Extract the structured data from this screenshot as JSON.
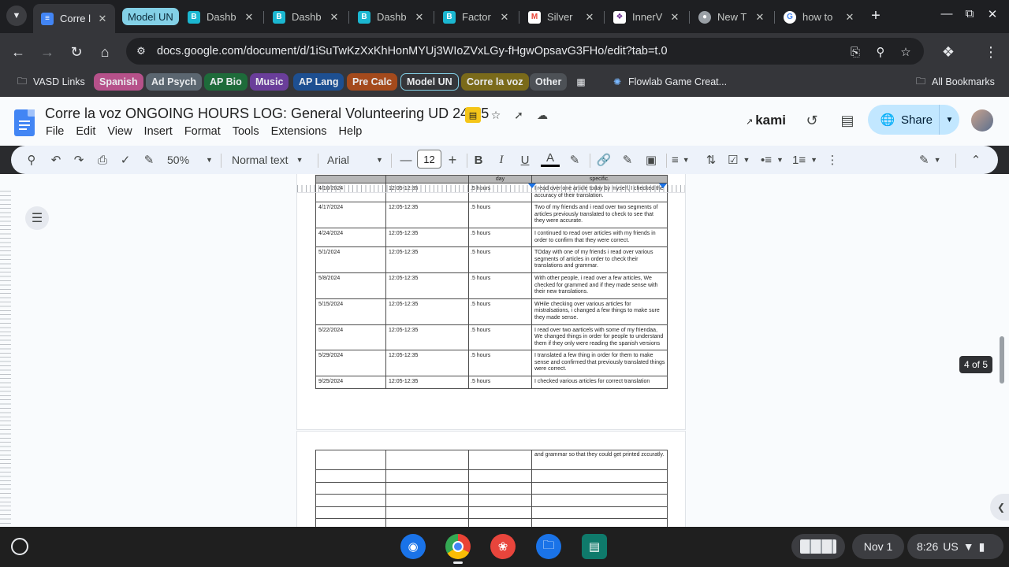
{
  "browser": {
    "tabs": [
      {
        "title": "Corre l",
        "favicon": "docs-icon",
        "color": "#4285f4",
        "active": true
      },
      {
        "title": "Dashb",
        "favicon": "b-icon",
        "color": "#1bb7d1"
      },
      {
        "title": "Dashb",
        "favicon": "b-icon",
        "color": "#1bb7d1"
      },
      {
        "title": "Dashb",
        "favicon": "b-icon",
        "color": "#1bb7d1"
      },
      {
        "title": "Factor",
        "favicon": "b-icon",
        "color": "#1bb7d1"
      },
      {
        "title": "Silver",
        "favicon": "gmail-icon",
        "color": "#ea4335"
      },
      {
        "title": "InnerV",
        "favicon": "innerv-icon",
        "color": "#6a2c91"
      },
      {
        "title": "New T",
        "favicon": "chrome-icon",
        "color": "#9aa0a6"
      },
      {
        "title": "how to",
        "favicon": "google-icon",
        "color": "#4285f4"
      }
    ],
    "tab_group": "Model UN",
    "url": "docs.google.com/document/d/1iSuTwKzXxKhHonMYUj3WIoZVxLGy-fHgwOpsavG3FHo/edit?tab=t.0",
    "bookmarks": [
      {
        "label": "VASD Links",
        "type": "folder"
      },
      {
        "label": "Spanish",
        "type": "group",
        "color": "#b6518a"
      },
      {
        "label": "Ad Psych",
        "type": "group",
        "color": "#5b6670"
      },
      {
        "label": "AP Bio",
        "type": "group",
        "color": "#1e6b3a"
      },
      {
        "label": "Music",
        "type": "group",
        "color": "#6a3e9a"
      },
      {
        "label": "AP Lang",
        "type": "group",
        "color": "#1d4f91"
      },
      {
        "label": "Pre Calc",
        "type": "group",
        "color": "#a44a1c"
      },
      {
        "label": "Model UN",
        "type": "group-outline",
        "color": "#83d0e6"
      },
      {
        "label": "Corre la voz",
        "type": "group",
        "color": "#7a6a1a"
      },
      {
        "label": "Other",
        "type": "group",
        "color": "#4d5156"
      },
      {
        "label": "Flowlab Game Creat...",
        "type": "link"
      },
      {
        "label": "All Bookmarks",
        "type": "folder"
      }
    ]
  },
  "docs": {
    "title": "Corre la voz  ONGOING HOURS LOG: General Volunteering UD 24-25",
    "menu": [
      "File",
      "Edit",
      "View",
      "Insert",
      "Format",
      "Tools",
      "Extensions",
      "Help"
    ],
    "kami": "kami",
    "share": "Share",
    "toolbar": {
      "zoom": "50%",
      "style": "Normal text",
      "font": "Arial",
      "font_size": "12"
    },
    "page_indicator": "4 of 5"
  },
  "table": {
    "header": [
      "",
      "",
      "day",
      "specific."
    ],
    "rows": [
      {
        "date": "4/10/2024",
        "time": "12:05-12:35",
        "hours": ".5 hours",
        "desc": "I read over one article today by myself, I checked the accuracy of their translation."
      },
      {
        "date": "4/17/2024",
        "time": "12:05-12:35",
        "hours": ".5 hours",
        "desc": "Two of my friends and i read over two segments of articles previously translated to check to see that they were accurate."
      },
      {
        "date": "4/24/2024",
        "time": "12:05-12:35",
        "hours": ".5 hours",
        "desc": "I continued to read over articles with my friends in order to confirm that they were correct."
      },
      {
        "date": "5/1/2024",
        "time": "12:05-12:35",
        "hours": ".5 hours",
        "desc": "TOday with one of my friends i read over various segments of articles in order to check their translations and grammar."
      },
      {
        "date": "5/8/2024",
        "time": "12:05-12:35",
        "hours": ".5 hours",
        "desc": "With other people, i read over a few articles, We checked for grammed and if they made sense with their new translations."
      },
      {
        "date": "5/15/2024",
        "time": "12:05-12:35",
        "hours": ".5 hours",
        "desc": "WHile checking over various articles for mistralsations, i changed a few things to make sure they made sense."
      },
      {
        "date": "5/22/2024",
        "time": "12:05-12:35",
        "hours": ".5 hours",
        "desc": "I read over two aarticels with some of my friendaa, We changed things in order for people to understand them if they only were reading the spanish versions"
      },
      {
        "date": "5/29/2024",
        "time": "12:05-12:35",
        "hours": ".5 hours",
        "desc": "I translated a few thing in order for them to make sense and confirmed that previously translated things were correct."
      },
      {
        "date": "9/25/2024",
        "time": "12:05-12:35",
        "hours": ".5 hours",
        "desc": "I checked various articles for correct translation"
      }
    ],
    "continuation": "and grammar so that they could get printed zccuratly."
  },
  "shelf": {
    "date": "Nov 1",
    "time": "8:26",
    "locale": "US"
  }
}
